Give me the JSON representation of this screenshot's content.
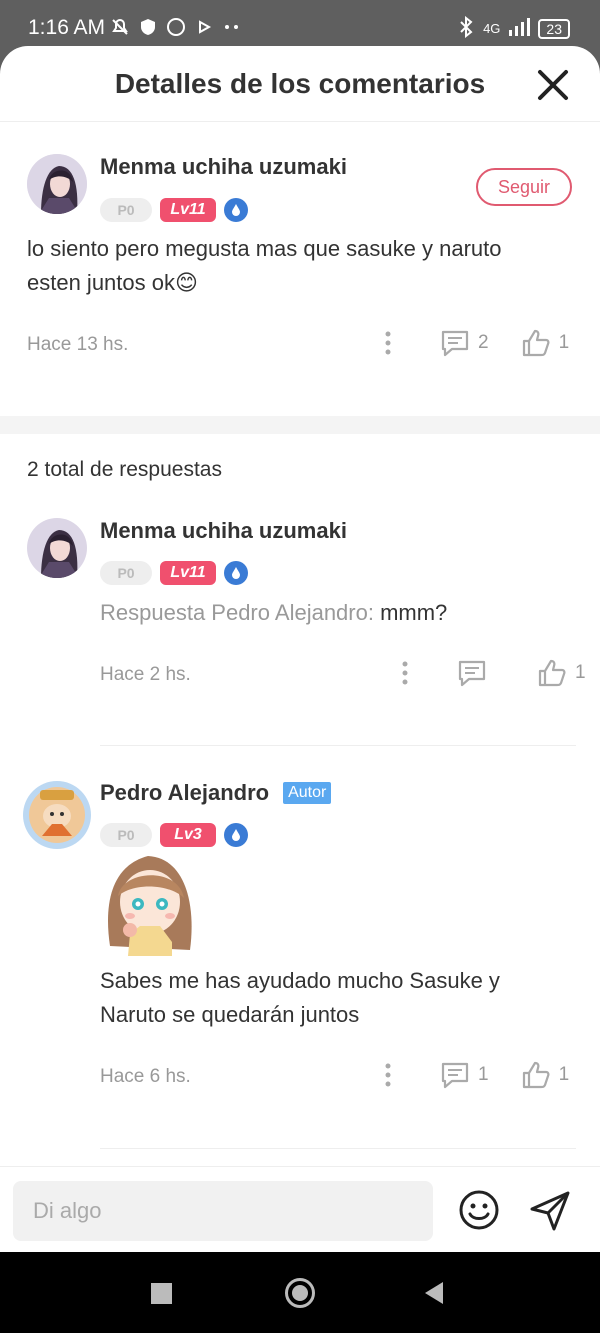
{
  "status_bar": {
    "time": "1:16 AM",
    "network": "4G",
    "battery": "23"
  },
  "header": {
    "title": "Detalles de los comentarios"
  },
  "main_comment": {
    "author": "Menma uchiha uzumaki",
    "p_badge": "P0",
    "level": "Lv11",
    "follow_label": "Seguir",
    "text": "lo siento pero megusta mas que sasuke y naruto esten juntos ok😊",
    "time": "Hace 13 hs.",
    "reply_count": "2",
    "like_count": "1"
  },
  "replies_total": "2 total de respuestas",
  "replies": [
    {
      "author": "Menma uchiha uzumaki",
      "p_badge": "P0",
      "level": "Lv11",
      "reply_prefix": "Respuesta Pedro Alejandro:",
      "text": " mmm?",
      "time": "Hace 2 hs.",
      "like_count": "1"
    },
    {
      "author": "Pedro Alejandro",
      "author_tag": "Autor",
      "p_badge": "P0",
      "level": "Lv3",
      "text": "Sabes me has ayudado mucho Sasuke y Naruto se quedarán juntos",
      "time": "Hace 6 hs.",
      "reply_count": "1",
      "like_count": "1"
    }
  ],
  "input": {
    "placeholder": "Di algo"
  },
  "colors": {
    "accent": "#e05a70",
    "level_badge": "#f0506e",
    "author_tag": "#5aa8f0",
    "drop_badge": "#3a7bd5"
  }
}
